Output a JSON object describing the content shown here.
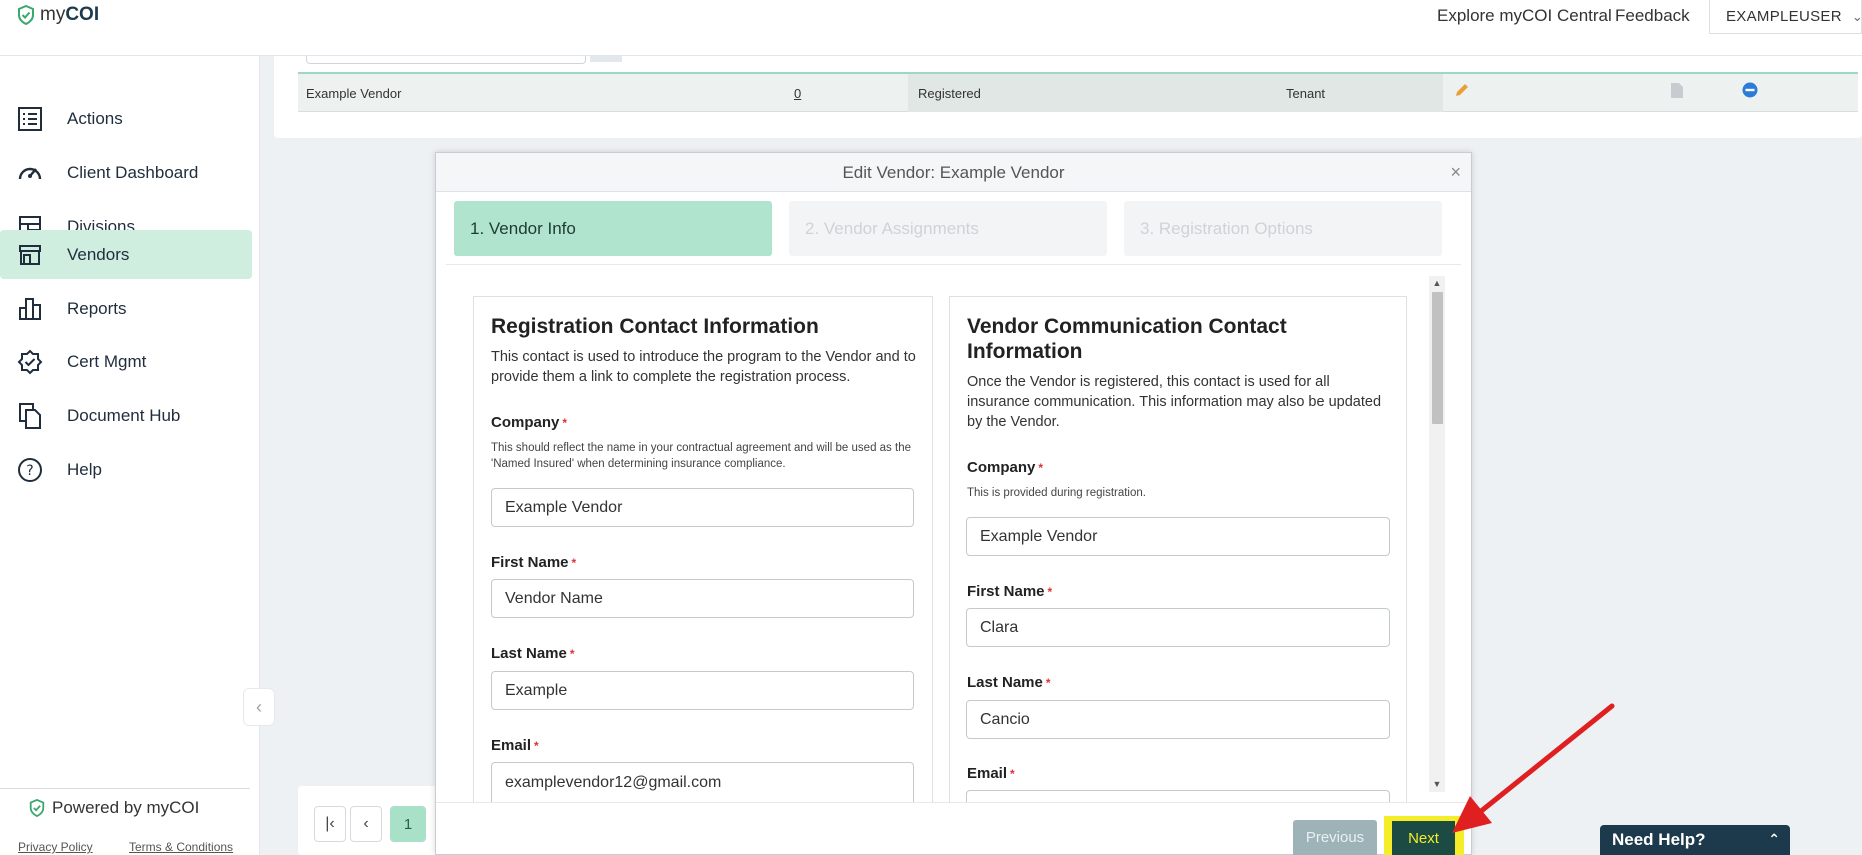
{
  "topbar": {
    "logo_my": "my",
    "logo_coi": "COI",
    "explore_link": "Explore myCOI Central",
    "feedback_link": "Feedback",
    "user_name": "EXAMPLEUSER"
  },
  "sidebar": {
    "items": [
      {
        "label": "Actions",
        "icon": "list-icon"
      },
      {
        "label": "Client Dashboard",
        "icon": "gauge-icon"
      },
      {
        "label": "Divisions",
        "icon": "layout-icon"
      },
      {
        "label": "Vendors",
        "icon": "store-icon",
        "active": true
      },
      {
        "label": "Reports",
        "icon": "bar-chart-icon"
      },
      {
        "label": "Cert Mgmt",
        "icon": "badge-check-icon"
      },
      {
        "label": "Document Hub",
        "icon": "documents-icon"
      },
      {
        "label": "Help",
        "icon": "help-icon"
      }
    ],
    "powered_by": "Powered by myCOI",
    "privacy": "Privacy Policy",
    "terms": "Terms & Conditions"
  },
  "table": {
    "row": {
      "vendor": "Example Vendor",
      "count": "0",
      "status": "Registered",
      "type": "Tenant"
    }
  },
  "pagination": {
    "current_page": "1"
  },
  "modal": {
    "title": "Edit Vendor: Example Vendor",
    "close": "×",
    "steps": [
      "1. Vendor Info",
      "2. Vendor Assignments",
      "3. Registration Options"
    ],
    "left_panel": {
      "title": "Registration Contact Information",
      "description": "This contact is used to introduce the program to the Vendor and to provide them a link to complete the registration process.",
      "company_label": "Company",
      "company_help": "This should reflect the name in your contractual agreement and will be used as the 'Named Insured' when determining insurance compliance.",
      "company_value": "Example Vendor",
      "first_name_label": "First Name",
      "first_name_value": "Vendor Name",
      "last_name_label": "Last Name",
      "last_name_value": "Example",
      "email_label": "Email",
      "email_value": "examplevendor12@gmail.com"
    },
    "right_panel": {
      "title_line1": "Vendor Communication Contact",
      "title_line2": "Information",
      "description": "Once the Vendor is registered, this contact is used for all insurance communication. This information may also be updated by the Vendor.",
      "company_label": "Company",
      "company_help": "This is provided during registration.",
      "company_value": "Example Vendor",
      "first_name_label": "First Name",
      "first_name_value": "Clara",
      "last_name_label": "Last Name",
      "last_name_value": "Cancio",
      "email_label": "Email"
    },
    "required_mark": "*",
    "previous_button": "Previous",
    "next_button": "Next"
  },
  "help_widget": {
    "label": "Need Help?"
  },
  "colors": {
    "brand_dark": "#1d3a4c",
    "active_nav": "#cfeee0",
    "active_step": "#b0e4cf",
    "highlight": "#f5ec2a",
    "annotation_arrow": "#e02020"
  }
}
